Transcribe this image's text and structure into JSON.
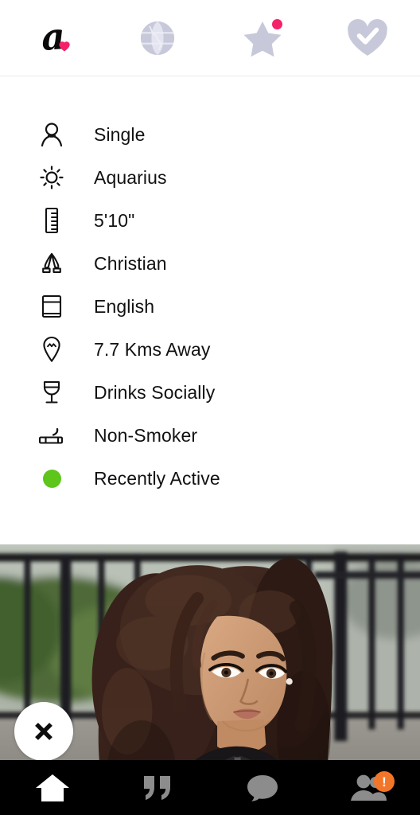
{
  "header": {
    "tabs": [
      {
        "name": "logo",
        "icon": "script-a-heart-logo-icon",
        "letter": "a",
        "badge": null
      },
      {
        "name": "explore",
        "icon": "globe-icon",
        "letter": "",
        "badge": null
      },
      {
        "name": "favorites",
        "icon": "star-icon",
        "letter": "",
        "badge": "dot"
      },
      {
        "name": "matches",
        "icon": "heart-check-icon",
        "letter": "",
        "badge": null
      }
    ],
    "colors": {
      "logo_ink": "#0a0a0a",
      "logo_heart": "#f4226a",
      "inactive_icon": "#c7c8d9",
      "badge_pink": "#f4226a",
      "divider": "#ececed"
    }
  },
  "profile_info": {
    "items": [
      {
        "icon": "person-icon",
        "label": "Single"
      },
      {
        "icon": "sun-icon",
        "label": "Aquarius"
      },
      {
        "icon": "ruler-icon",
        "label": "5'10\""
      },
      {
        "icon": "praying-hands-icon",
        "label": "Christian"
      },
      {
        "icon": "book-icon",
        "label": "English"
      },
      {
        "icon": "location-pin-icon",
        "label": "7.7 Kms Away"
      },
      {
        "icon": "wine-glass-icon",
        "label": "Drinks Socially"
      },
      {
        "icon": "cigarette-icon",
        "label": "Non-Smoker"
      },
      {
        "icon": "status-dot-icon",
        "label": "Recently Active"
      }
    ],
    "status_color": "#5ec51b",
    "text_color": "#111113"
  },
  "photo": {
    "alt_description": "Portrait of a woman with long curly hair in a black mesh jacket standing in front of a black metal fence with green hedges",
    "close_button": {
      "icon": "close-x-icon",
      "label": "✕"
    }
  },
  "bottom_nav": {
    "items": [
      {
        "name": "home",
        "icon": "home-icon",
        "active": true,
        "badge": null
      },
      {
        "name": "quotes",
        "icon": "quote-marks-icon",
        "active": false,
        "badge": null
      },
      {
        "name": "messages",
        "icon": "chat-bubble-icon",
        "active": false,
        "badge": null
      },
      {
        "name": "profile",
        "icon": "person-group-icon",
        "active": false,
        "badge": "!"
      }
    ],
    "colors": {
      "bar_bg": "#000000",
      "active": "#ffffff",
      "inactive": "#8c8c8c",
      "badge": "#f2762a"
    }
  }
}
